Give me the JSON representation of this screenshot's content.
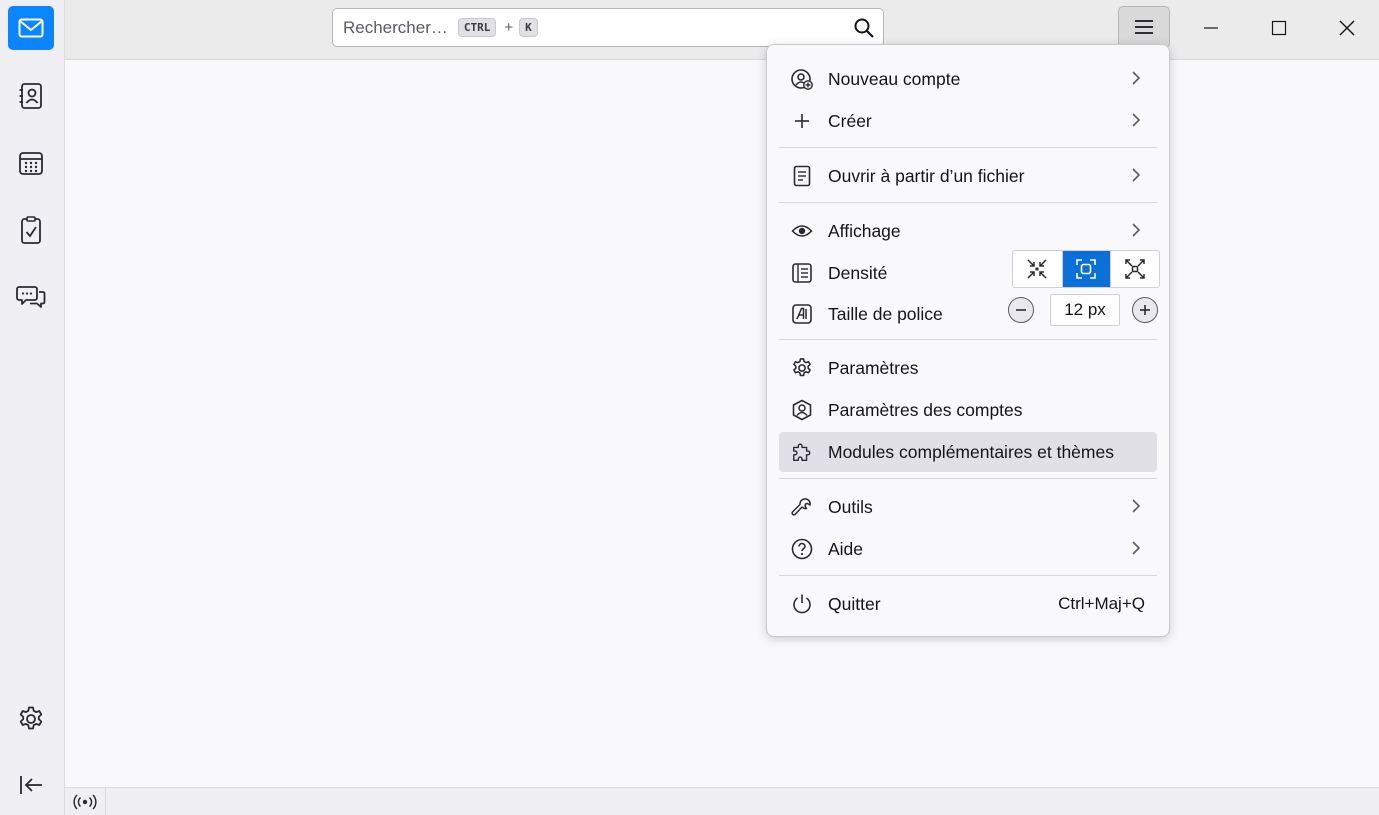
{
  "search": {
    "placeholder": "Rechercher…",
    "kbd_ctrl": "CTRL",
    "kbd_plus": "+",
    "kbd_key": "K"
  },
  "colors": {
    "accent": "#0a84ff",
    "density_selected": "#0a6fd6",
    "highlight": "#e0e0e6"
  },
  "spaces": [
    "mail-icon",
    "address-book-icon",
    "calendar-icon",
    "tasks-icon",
    "chat-icon",
    "settings-icon",
    "collapse-icon"
  ],
  "appmenu": {
    "new_account": "Nouveau compte",
    "create": "Créer",
    "open_file": "Ouvrir à partir d’un fichier",
    "view": "Affichage",
    "density": "Densité",
    "font_size": "Taille de police",
    "font_size_value": "12 px",
    "settings": "Paramètres",
    "account_settings": "Paramètres des comptes",
    "addons": "Modules complémentaires et thèmes",
    "tools": "Outils",
    "help": "Aide",
    "quit": "Quitter",
    "quit_shortcut": "Ctrl+Maj+Q"
  },
  "density_options": [
    "compact",
    "normal",
    "touch"
  ],
  "density_selected": "normal"
}
